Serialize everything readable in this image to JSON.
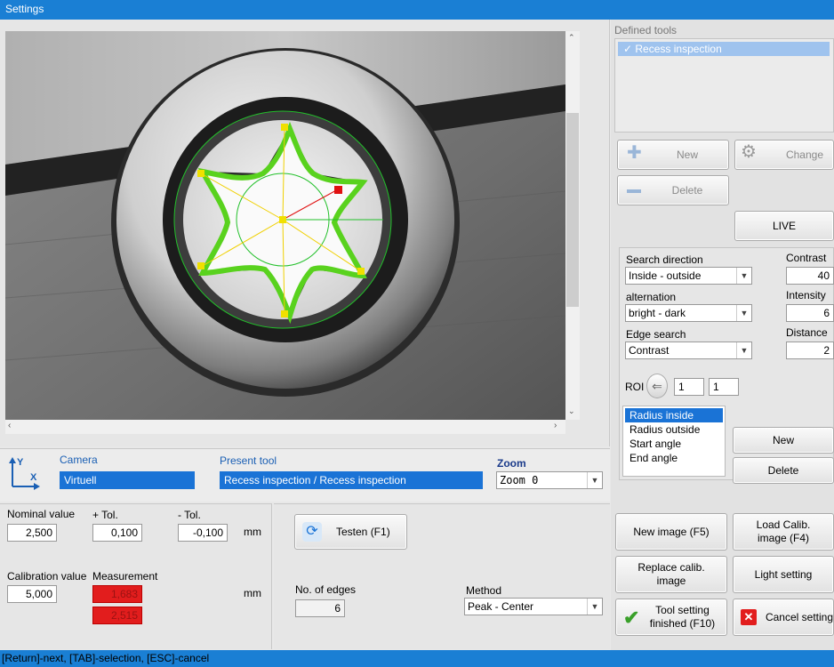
{
  "window": {
    "title": "Settings"
  },
  "camera_view": {},
  "defined_tools": {
    "title": "Defined tools",
    "items": [
      {
        "label": "✓ Recess inspection",
        "selected": true
      }
    ],
    "new_label": "New",
    "change_label": "Change",
    "delete_label": "Delete",
    "live_label": "LIVE"
  },
  "params": {
    "search_direction_label": "Search direction",
    "search_direction_value": "Inside - outside",
    "alternation_label": "alternation",
    "alternation_value": "bright - dark",
    "edge_search_label": "Edge search",
    "edge_search_value": "Contrast",
    "contrast_label": "Contrast",
    "contrast_value": "40",
    "intensity_label": "Intensity",
    "intensity_value": "6",
    "distance_label": "Distance",
    "distance_value": "2",
    "roi_label": "ROI",
    "roi_value_1": "1",
    "roi_value_2": "1",
    "roi_list": [
      "Radius inside",
      "Radius outside",
      "Start angle",
      "End angle"
    ],
    "new_label": "New",
    "delete_label": "Delete"
  },
  "info_bar": {
    "axis_y": "Y",
    "axis_x": "X",
    "camera_label": "Camera",
    "camera_value": "Virtuell",
    "present_tool_label": "Present tool",
    "present_tool_value": "Recess inspection / Recess inspection",
    "zoom_label": "Zoom",
    "zoom_value": "Zoom 0"
  },
  "measurement": {
    "nominal_label": "Nominal value",
    "nominal_value": "2,500",
    "plus_tol_label": "+ Tol.",
    "plus_tol_value": "0,100",
    "minus_tol_label": "- Tol.",
    "minus_tol_value": "-0,100",
    "unit": "mm",
    "calibration_label": "Calibration value",
    "calibration_value": "5,000",
    "measurement_label": "Measurement",
    "measurement_value_1": "1,683",
    "measurement_value_2": "2,515",
    "unit2": "mm"
  },
  "test": {
    "test_label": "Testen (F1)",
    "edges_label": "No. of edges",
    "edges_value": "6",
    "method_label": "Method",
    "method_value": "Peak - Center"
  },
  "actions": {
    "new_image": "New image (F5)",
    "load_calib": "Load Calib. image (F4)",
    "replace_calib": "Replace calib. image",
    "light_setting": "Light setting",
    "tool_finished": "Tool setting finished (F10)",
    "cancel": "Cancel setting"
  },
  "status": {
    "text": "[Return]-next,  [TAB]-selection,  [ESC]-cancel"
  },
  "colors": {
    "accent": "#1a7fd4",
    "error": "#e21d1d",
    "contour": "#5fd12a",
    "guide": "#f0d000"
  }
}
